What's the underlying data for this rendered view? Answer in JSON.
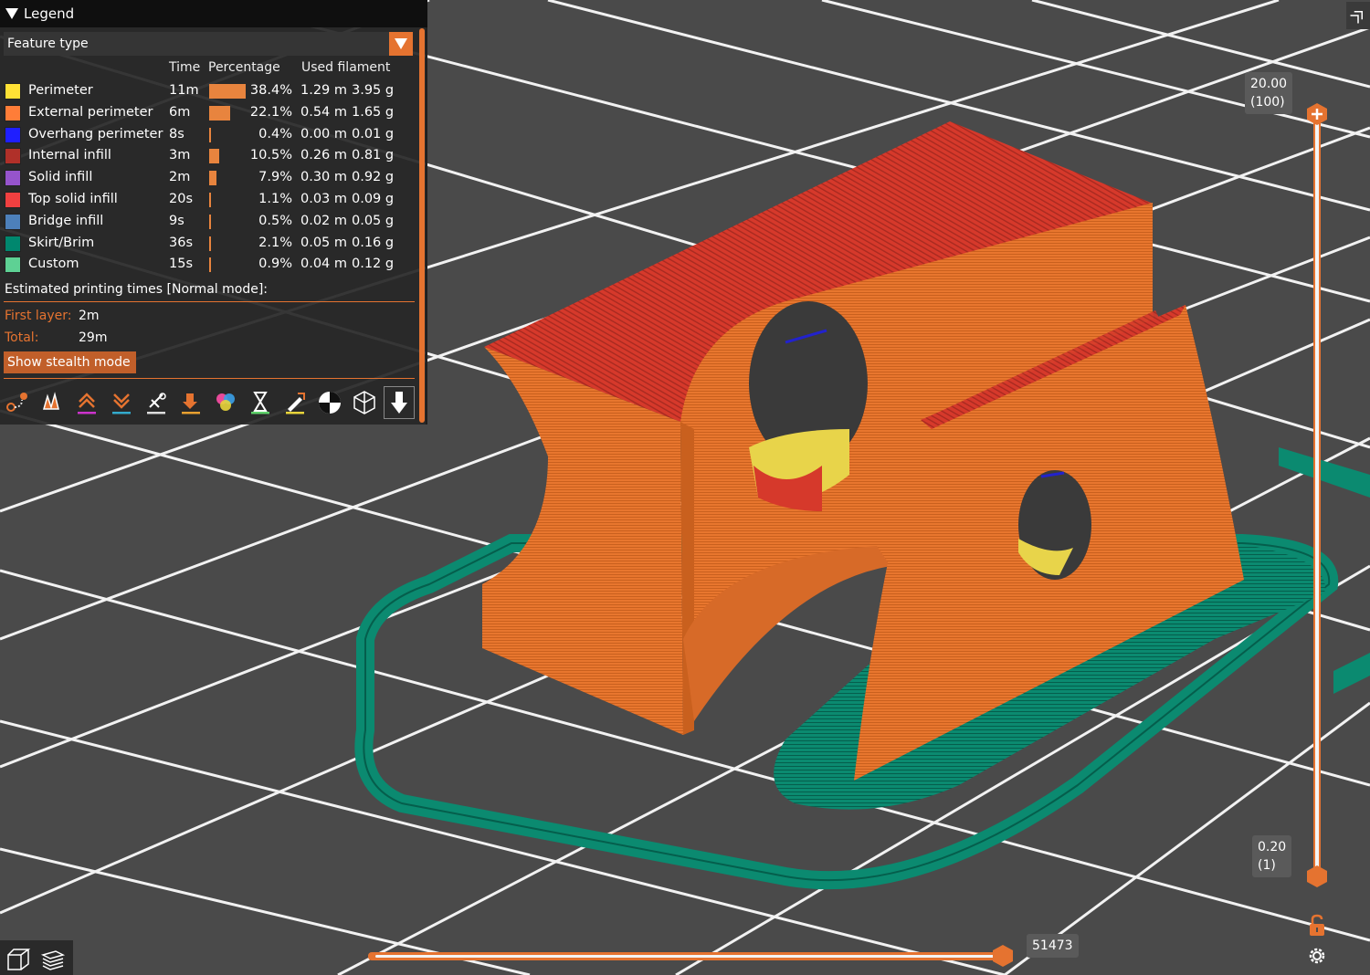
{
  "legend": {
    "title": "Legend",
    "view_type": "Feature type",
    "columns": {
      "time": "Time",
      "percentage": "Percentage",
      "used_filament": "Used filament"
    },
    "rows": [
      {
        "name": "Perimeter",
        "color": "#ffe135",
        "time": "11m",
        "pct": "38.4%",
        "pct_value": 38.4,
        "length": "1.29 m",
        "weight": "3.95 g"
      },
      {
        "name": "External perimeter",
        "color": "#ff7d38",
        "time": "6m",
        "pct": "22.1%",
        "pct_value": 22.1,
        "length": "0.54 m",
        "weight": "1.65 g"
      },
      {
        "name": "Overhang perimeter",
        "color": "#1f1fff",
        "time": "8s",
        "pct": "0.4%",
        "pct_value": 0.4,
        "length": "0.00 m",
        "weight": "0.01 g"
      },
      {
        "name": "Internal infill",
        "color": "#b03029",
        "time": "3m",
        "pct": "10.5%",
        "pct_value": 10.5,
        "length": "0.26 m",
        "weight": "0.81 g"
      },
      {
        "name": "Solid infill",
        "color": "#9654cc",
        "time": "2m",
        "pct": "7.9%",
        "pct_value": 7.9,
        "length": "0.30 m",
        "weight": "0.92 g"
      },
      {
        "name": "Top solid infill",
        "color": "#f04040",
        "time": "20s",
        "pct": "1.1%",
        "pct_value": 1.1,
        "length": "0.03 m",
        "weight": "0.09 g"
      },
      {
        "name": "Bridge infill",
        "color": "#4d80ba",
        "time": "9s",
        "pct": "0.5%",
        "pct_value": 0.5,
        "length": "0.02 m",
        "weight": "0.05 g"
      },
      {
        "name": "Skirt/Brim",
        "color": "#00876e",
        "time": "36s",
        "pct": "2.1%",
        "pct_value": 2.1,
        "length": "0.05 m",
        "weight": "0.16 g"
      },
      {
        "name": "Custom",
        "color": "#5ed194",
        "time": "15s",
        "pct": "0.9%",
        "pct_value": 0.9,
        "length": "0.04 m",
        "weight": "0.12 g"
      }
    ],
    "estimate_title": "Estimated printing times [Normal mode]:",
    "first_layer_label": "First layer:",
    "first_layer_value": "2m",
    "total_label": "Total:",
    "total_value": "29m",
    "stealth_button": "Show stealth mode",
    "toolbar_icons": [
      "travel-icon",
      "wipe-icon",
      "retractions-icon",
      "deretractions-icon",
      "seams-icon",
      "tool-changes-icon",
      "color-changes-icon",
      "pause-prints-icon",
      "custom-gcodes-icon",
      "center-of-gravity-icon",
      "shells-icon",
      "tool-marker-icon"
    ]
  },
  "vertical_slider": {
    "top_value": "20.00",
    "top_layer": "(100)",
    "bottom_value": "0.20",
    "bottom_layer": "(1)"
  },
  "horizontal_slider": {
    "value": "51473"
  },
  "colors": {
    "accent": "#e57330",
    "background": "#4a4a4a",
    "model_orange": "#e8762e",
    "brim_green": "#0a7a63",
    "top_red": "#d23a2a"
  }
}
